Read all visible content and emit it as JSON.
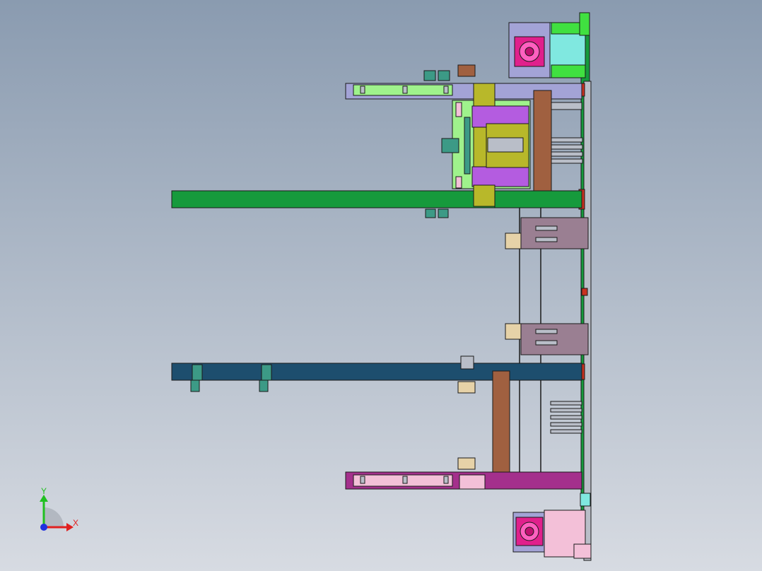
{
  "viewport": {
    "background_top": "#8a9bb0",
    "background_bottom": "#d7dbe2"
  },
  "triad": {
    "x_label": "X",
    "y_label": "Y",
    "x_color": "#e02020",
    "y_color": "#20c020",
    "z_color": "#2030e0"
  },
  "colors": {
    "outline": "#1a1a1a",
    "lavender": "#a3a3d6",
    "light_green": "#9ff28c",
    "olive": "#b8b82a",
    "purple": "#b45ce0",
    "green": "#169a3c",
    "navy": "#1d4e6e",
    "brown": "#a06040",
    "mauve": "#9a7f92",
    "magenta_plate": "#a4308c",
    "pink": "#f3c0d8",
    "cyan": "#80e8e0",
    "lime": "#40e040",
    "hot_pink": "#e0208c",
    "red": "#c83020",
    "teal": "#3c9a86",
    "beige": "#e6d2a8",
    "steel": "#b9bec8"
  }
}
